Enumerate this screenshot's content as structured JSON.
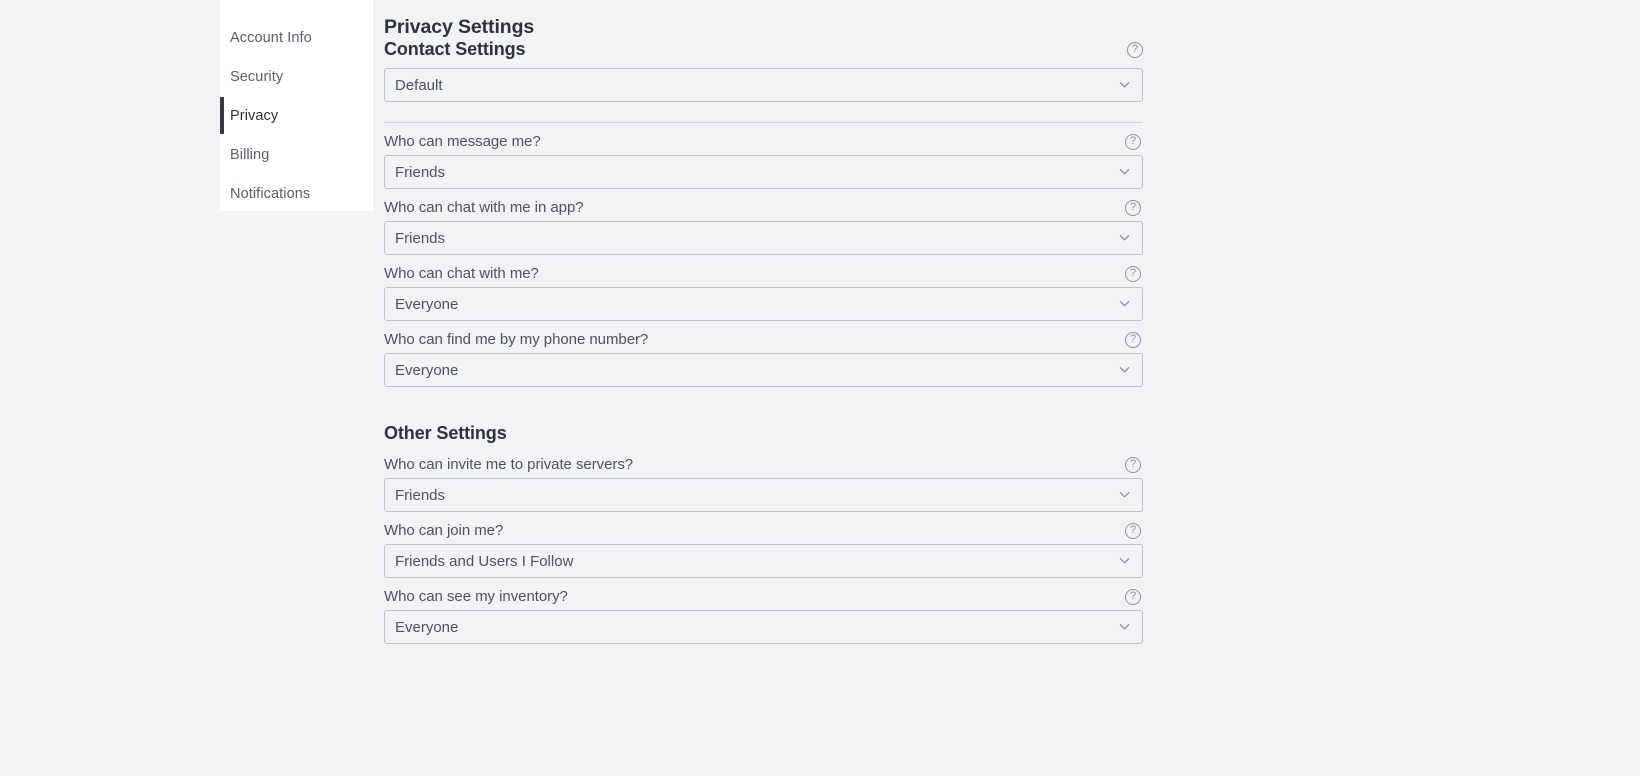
{
  "sidebar": {
    "items": [
      {
        "label": "Account Info",
        "active": false
      },
      {
        "label": "Security",
        "active": false
      },
      {
        "label": "Privacy",
        "active": true
      },
      {
        "label": "Billing",
        "active": false
      },
      {
        "label": "Notifications",
        "active": false
      }
    ]
  },
  "page": {
    "title": "Privacy Settings"
  },
  "icons": {
    "help": "?",
    "help_name": "help-icon",
    "chevron_name": "chevron-down-icon"
  },
  "colors": {
    "page_background": "#f2f3f5",
    "panel_background": "#ffffff",
    "active_indicator": "#393b40",
    "heading_text": "#2e3338",
    "label_text": "#4e535a",
    "input_border": "#bfc3c9",
    "icon_gray": "#8e949d"
  },
  "sections": [
    {
      "heading": "Contact Settings",
      "has_heading_help": true,
      "top_select": {
        "value": "Default"
      },
      "has_divider_after_top_select": true,
      "fields": [
        {
          "label": "Who can message me?",
          "value": "Friends"
        },
        {
          "label": "Who can chat with me in app?",
          "value": "Friends"
        },
        {
          "label": "Who can chat with me?",
          "value": "Everyone"
        },
        {
          "label": "Who can find me by my phone number?",
          "value": "Everyone"
        }
      ]
    },
    {
      "heading": "Other Settings",
      "has_heading_help": false,
      "fields": [
        {
          "label": "Who can invite me to private servers?",
          "value": "Friends"
        },
        {
          "label": "Who can join me?",
          "value": "Friends and Users I Follow"
        },
        {
          "label": "Who can see my inventory?",
          "value": "Everyone"
        }
      ]
    }
  ]
}
